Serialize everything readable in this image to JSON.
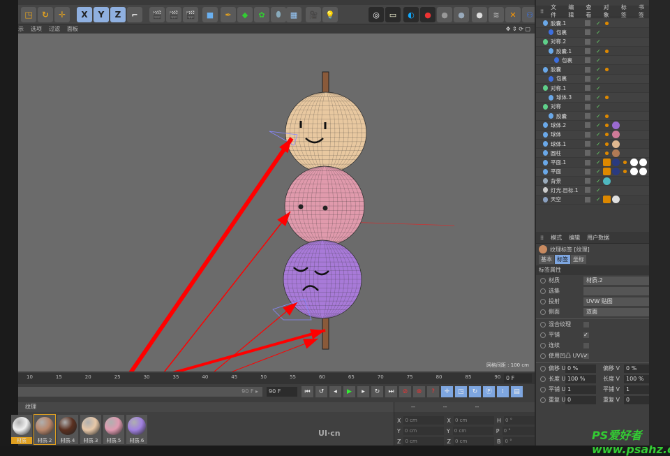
{
  "viewport": {
    "menu": [
      "示",
      "选项",
      "过滤",
      "面板"
    ],
    "grid_label": "网格间距 : 100 cm"
  },
  "toolbar": {
    "axis": [
      "X",
      "Y",
      "Z"
    ],
    "icons": [
      "scale-icon",
      "rotate-icon",
      "move-icon",
      "coordinate-icon",
      "render-view-icon",
      "render-picture-icon",
      "render-settings-icon",
      "cube-icon",
      "pen-icon",
      "subdivision-icon",
      "array-icon",
      "deformer-icon",
      "floor-icon",
      "camera-icon",
      "light-icon",
      "ambient-occlusion-icon",
      "light-tool-icon",
      "contrast-icon",
      "record-icon",
      "sphere-material-icon",
      "glass-icon",
      "chrome-icon",
      "hair-icon",
      "mograph-icon",
      "scene-icon"
    ]
  },
  "object_manager": {
    "menu": [
      "文件",
      "编辑",
      "查看",
      "对象",
      "标签",
      "书签"
    ],
    "objects": [
      {
        "name": "胶囊.1",
        "indent": 0,
        "color": "#6aa8e8",
        "tags": [
          "phong"
        ]
      },
      {
        "name": "包裹",
        "indent": 1,
        "color": "#3d6fe0",
        "tags": []
      },
      {
        "name": "对称.2",
        "indent": 0,
        "color": "#5fd08a",
        "tags": []
      },
      {
        "name": "胶囊.1",
        "indent": 1,
        "color": "#6aa8e8",
        "tags": [
          "phong"
        ]
      },
      {
        "name": "包裹",
        "indent": 2,
        "color": "#3d6fe0",
        "tags": []
      },
      {
        "name": "胶囊",
        "indent": 0,
        "color": "#6aa8e8",
        "tags": [
          "phong"
        ]
      },
      {
        "name": "包裹",
        "indent": 1,
        "color": "#3d6fe0",
        "tags": []
      },
      {
        "name": "对称.1",
        "indent": 0,
        "color": "#5fd08a",
        "tags": []
      },
      {
        "name": "球体.3",
        "indent": 1,
        "color": "#6aa8e8",
        "tags": [
          "phong"
        ]
      },
      {
        "name": "对称",
        "indent": 0,
        "color": "#5fd08a",
        "tags": []
      },
      {
        "name": "胶囊",
        "indent": 1,
        "color": "#6aa8e8",
        "tags": [
          "phong"
        ]
      },
      {
        "name": "球体.2",
        "indent": 0,
        "color": "#6aa8e8",
        "tags": [
          "phong",
          "#9a6ad0"
        ]
      },
      {
        "name": "球体",
        "indent": 0,
        "color": "#6aa8e8",
        "tags": [
          "phong",
          "#d07a98"
        ]
      },
      {
        "name": "球体.1",
        "indent": 0,
        "color": "#6aa8e8",
        "tags": [
          "phong",
          "#e0b890"
        ]
      },
      {
        "name": "圆柱",
        "indent": 0,
        "color": "#6aa8e8",
        "tags": [
          "phong",
          "#b07a55"
        ]
      },
      {
        "name": "平面.1",
        "indent": 0,
        "color": "#6aa8e8",
        "tags": [
          "clap",
          "target",
          "phong",
          "#ffffff",
          "#ffffff"
        ]
      },
      {
        "name": "平面",
        "indent": 0,
        "color": "#6aa8e8",
        "tags": [
          "clap",
          "target",
          "phong",
          "#ffffff",
          "#ffffff"
        ]
      },
      {
        "name": "背景",
        "indent": 0,
        "color": "#9ab",
        "tags": [
          "#4fb8c0"
        ]
      },
      {
        "name": "灯光.目标.1",
        "indent": 0,
        "color": "#ccc",
        "tags": []
      },
      {
        "name": "天空",
        "indent": 0,
        "color": "#8aa0c0",
        "tags": [
          "clap",
          "#e0e0e0"
        ]
      }
    ]
  },
  "attributes": {
    "menu": [
      "模式",
      "编辑",
      "用户数据"
    ],
    "title": "纹理标签 [纹理]",
    "tabs": [
      "基本",
      "标签",
      "坐标"
    ],
    "active_tab": "标签",
    "section": "标签属性",
    "fields": [
      {
        "label": "材质",
        "value": "材质.2"
      },
      {
        "label": "选集",
        "value": ""
      },
      {
        "label": "投射",
        "value": "UVW 贴图"
      },
      {
        "label": "侧面",
        "value": "双面"
      }
    ],
    "checks": [
      {
        "label": "混合纹理",
        "checked": false
      },
      {
        "label": "平铺",
        "checked": true
      },
      {
        "label": "连续",
        "checked": false
      },
      {
        "label": "使用凹凸 UVW",
        "checked": true
      }
    ],
    "pairs": [
      {
        "l1": "偏移 U",
        "v1": "0 %",
        "l2": "偏移 V",
        "v2": "0 %"
      },
      {
        "l1": "长度 U",
        "v1": "100 %",
        "l2": "长度 V",
        "v2": "100 %"
      },
      {
        "l1": "平铺 U",
        "v1": "1",
        "l2": "平铺 V",
        "v2": "1"
      },
      {
        "l1": "重复 U",
        "v1": "0",
        "l2": "重复 V",
        "v2": "0"
      }
    ]
  },
  "timeline": {
    "ticks": [
      "10",
      "15",
      "20",
      "25",
      "30",
      "35",
      "40",
      "45",
      "50",
      "55",
      "60",
      "65",
      "70",
      "75",
      "80",
      "85",
      "90"
    ],
    "current_frame": "0 F",
    "end_label": "90 F",
    "end_field": "90 F"
  },
  "materials": {
    "header": "纹理",
    "items": [
      {
        "name": "材质",
        "color": "#f0f0f0"
      },
      {
        "name": "材质.2",
        "color": "#b8866a"
      },
      {
        "name": "材质.4",
        "color": "#5a3020"
      },
      {
        "name": "材质.3",
        "color": "#e8c8a8"
      },
      {
        "name": "材质.5",
        "color": "#e09ab0"
      },
      {
        "name": "材质.6",
        "color": "#a080e0"
      }
    ]
  },
  "coordinates": {
    "header": [
      "--",
      "--",
      "--"
    ],
    "rows": [
      {
        "a": "X",
        "av": "0 cm",
        "b": "X",
        "bv": "0 cm",
        "c": "H",
        "cv": "0 °"
      },
      {
        "a": "Y",
        "av": "0 cm",
        "b": "Y",
        "bv": "0 cm",
        "c": "P",
        "cv": "0 °"
      },
      {
        "a": "Z",
        "av": "0 cm",
        "b": "Z",
        "bv": "0 cm",
        "c": "B",
        "cv": "0 °"
      }
    ]
  },
  "watermark": {
    "logo": "UI·cn",
    "site": "PS爱好者 www.psahz.com"
  }
}
